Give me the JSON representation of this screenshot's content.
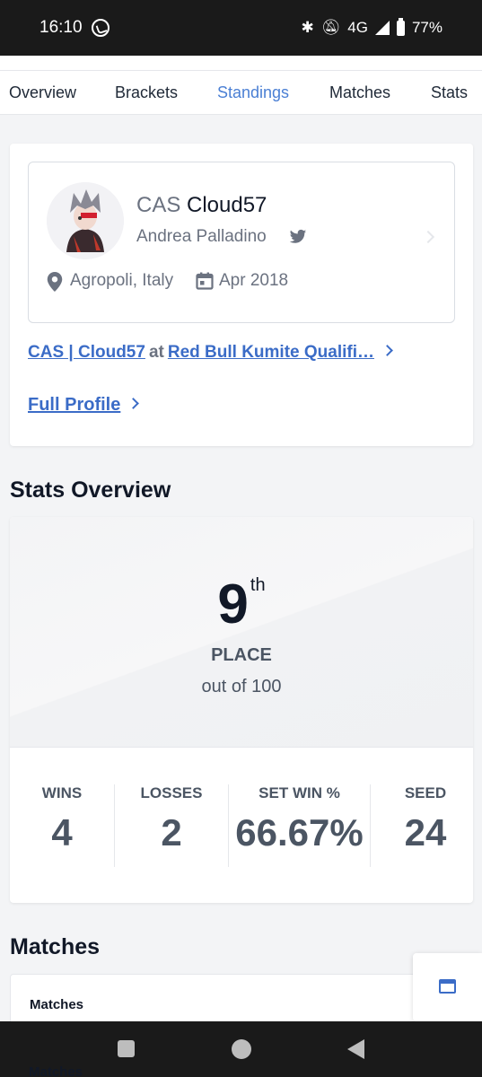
{
  "status_bar": {
    "time": "16:10",
    "network": "4G",
    "battery": "77%",
    "icons": [
      "whatsapp-icon",
      "bluetooth-icon",
      "mute-icon",
      "signal-icon",
      "battery-icon"
    ]
  },
  "tabs": [
    {
      "label": "Overview",
      "active": false
    },
    {
      "label": "Brackets",
      "active": false
    },
    {
      "label": "Standings",
      "active": true
    },
    {
      "label": "Matches",
      "active": false
    },
    {
      "label": "Stats",
      "active": false
    }
  ],
  "profile": {
    "prefix": "CAS",
    "gamertag": "Cloud57",
    "real_name": "Andrea Palladino",
    "location": "Agropoli, Italy",
    "joined": "Apr 2018",
    "event_entrant": "CAS | Cloud57",
    "event_at": "at",
    "event_name": "Red Bull Kumite Qualifi…",
    "full_profile_label": "Full Profile"
  },
  "stats": {
    "section_title": "Stats Overview",
    "placement": "9",
    "placement_suffix": "th",
    "placement_label": "PLACE",
    "out_of": "out of 100",
    "items": [
      {
        "label": "WINS",
        "value": "4"
      },
      {
        "label": "LOSSES",
        "value": "2"
      },
      {
        "label": "SET WIN %",
        "value": "66.67%"
      },
      {
        "label": "SEED",
        "value": "24"
      }
    ]
  },
  "matches": {
    "section_title": "Matches",
    "card_label": "Matches",
    "peek_label": "Matches"
  },
  "colors": {
    "accent": "#3b6cc7",
    "active_tab": "#4a7fd4",
    "text_muted": "#6b7280"
  }
}
